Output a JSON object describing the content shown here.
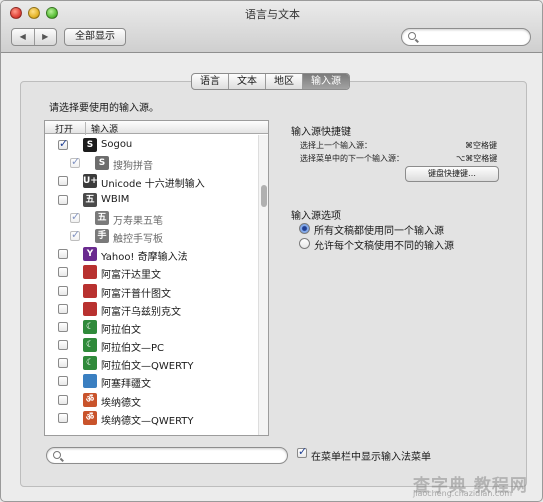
{
  "window": {
    "title": "语言与文本"
  },
  "toolbar": {
    "back": "◀",
    "forward": "▶",
    "show_all": "全部显示",
    "search_placeholder": ""
  },
  "tabs": [
    {
      "label": "语言"
    },
    {
      "label": "文本"
    },
    {
      "label": "地区"
    },
    {
      "label": "输入源",
      "active": true
    }
  ],
  "prompt": "请选择要使用的输入源。",
  "list": {
    "col_enable": "打开",
    "col_source": "输入源",
    "rows": [
      {
        "label": "Sogou",
        "checked": true,
        "sub": false,
        "icon": "S",
        "icon_color": "#1c1c1c"
      },
      {
        "label": "搜狗拼音",
        "checked": true,
        "sub": true,
        "icon": "S",
        "icon_color": "#6d6d6d"
      },
      {
        "label": "Unicode 十六进制输入",
        "checked": false,
        "sub": false,
        "icon": "U+",
        "icon_color": "#3b3b3b"
      },
      {
        "label": "WBIM",
        "checked": false,
        "sub": false,
        "icon": "五",
        "icon_color": "#4a4a4a"
      },
      {
        "label": "万寿果五笔",
        "checked": true,
        "sub": true,
        "icon": "五",
        "icon_color": "#7a7a7a"
      },
      {
        "label": "触控手写板",
        "checked": true,
        "sub": true,
        "icon": "手",
        "icon_color": "#7a7a7a"
      },
      {
        "label": "Yahoo! 奇摩输入法",
        "checked": false,
        "sub": false,
        "icon": "Y",
        "icon_color": "#6a2a8f"
      },
      {
        "label": "阿富汗达里文",
        "checked": false,
        "sub": false,
        "icon": "",
        "icon_color": "#b8312f"
      },
      {
        "label": "阿富汗普什图文",
        "checked": false,
        "sub": false,
        "icon": "",
        "icon_color": "#b8312f"
      },
      {
        "label": "阿富汗乌兹别克文",
        "checked": false,
        "sub": false,
        "icon": "",
        "icon_color": "#b8312f"
      },
      {
        "label": "阿拉伯文",
        "checked": false,
        "sub": false,
        "icon": "☾",
        "icon_color": "#2f8a3a"
      },
      {
        "label": "阿拉伯文—PC",
        "checked": false,
        "sub": false,
        "icon": "☾",
        "icon_color": "#2f8a3a"
      },
      {
        "label": "阿拉伯文—QWERTY",
        "checked": false,
        "sub": false,
        "icon": "☾",
        "icon_color": "#2f8a3a"
      },
      {
        "label": "阿塞拜疆文",
        "checked": false,
        "sub": false,
        "icon": "",
        "icon_color": "#3a7fc1"
      },
      {
        "label": "埃纳德文",
        "checked": false,
        "sub": false,
        "icon": "ॐ",
        "icon_color": "#c9532b"
      },
      {
        "label": "埃纳德文—QWERTY",
        "checked": false,
        "sub": false,
        "icon": "ॐ",
        "icon_color": "#c9532b"
      }
    ]
  },
  "shortcuts": {
    "heading": "输入源快捷键",
    "prev_label": "选择上一个输入源：",
    "prev_key": "⌘空格键",
    "next_label": "选择菜单中的下一个输入源：",
    "next_key": "⌥⌘空格键",
    "keyboard_shortcuts_button": "键盘快捷键…"
  },
  "options": {
    "heading": "输入源选项",
    "same_for_all": "所有文稿都使用同一个输入源",
    "allow_different": "允许每个文稿使用不同的输入源",
    "selected": "same_for_all"
  },
  "bottom": {
    "search_placeholder": "",
    "show_in_menu_bar": "在菜单栏中显示输入法菜单",
    "show_in_menu_bar_checked": true
  },
  "watermark": {
    "line1": "查字典 教程网",
    "line2": "jiaocheng.chazidian.com"
  }
}
